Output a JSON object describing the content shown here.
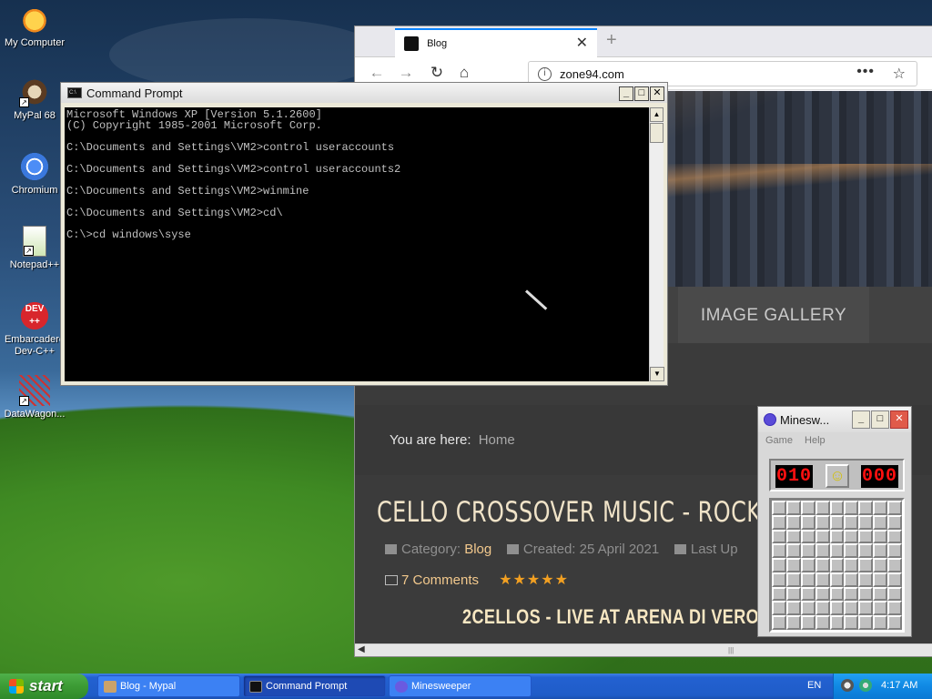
{
  "desktop": {
    "icons": [
      {
        "label": "My Computer"
      },
      {
        "label": "MyPal 68"
      },
      {
        "label": "Chromium"
      },
      {
        "label": "Notepad++"
      },
      {
        "label": "Embarcadero Dev-C++"
      },
      {
        "label": "DataWagon..."
      }
    ]
  },
  "browser": {
    "tab_title": "Blog",
    "url": "zone94.com",
    "page": {
      "nav_item": "IMAGE GALLERY",
      "breadcrumb_label": "You are here:",
      "breadcrumb_home": "Home",
      "article_title": "CELLO CROSSOVER MUSIC - ROCK",
      "category_label": "Category:",
      "category_value": "Blog",
      "created": "Created: 25 April 2021",
      "last_updated": "Last Up",
      "comments": "7 Comments",
      "rating_stars": "★★★★★",
      "subtitle": "2CELLOS - LIVE AT ARENA DI VERON"
    }
  },
  "cmd": {
    "title": "Command Prompt",
    "output": "Microsoft Windows XP [Version 5.1.2600]\n(C) Copyright 1985-2001 Microsoft Corp.\n\nC:\\Documents and Settings\\VM2>control useraccounts\n\nC:\\Documents and Settings\\VM2>control useraccounts2\n\nC:\\Documents and Settings\\VM2>winmine\n\nC:\\Documents and Settings\\VM2>cd\\\n\nC:\\>cd windows\\syse"
  },
  "minesweeper": {
    "title": "Minesweeper",
    "title_display": "Minesw...",
    "menu_game": "Game",
    "menu_help": "Help",
    "mines_counter": "010",
    "timer": "000",
    "face": "☺"
  },
  "taskbar": {
    "start_label": "start",
    "tasks": [
      {
        "label": "Blog - Mypal"
      },
      {
        "label": "Command Prompt"
      },
      {
        "label": "Minesweeper"
      }
    ],
    "language": "EN",
    "clock": "4:17 AM"
  },
  "colors": {
    "accent_tab": "#0a84ff",
    "taskbar_blue": "#2361d1",
    "start_green": "#3c9b34",
    "title_gold": "#f0e3c8",
    "star_orange": "#f2a022",
    "led_red": "#ff1010"
  }
}
